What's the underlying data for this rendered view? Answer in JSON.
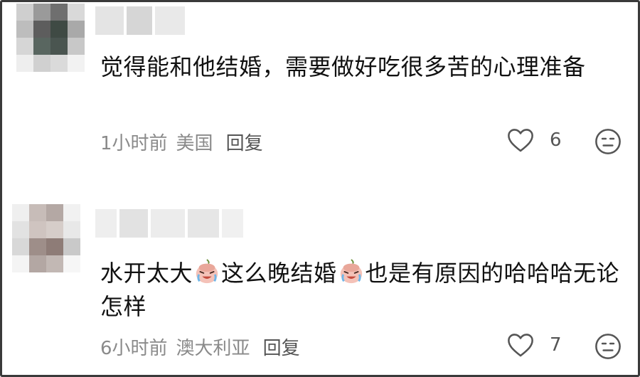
{
  "comments": [
    {
      "text": "觉得能和他结婚，需要做好吃很多苦的心理准备",
      "time": "1小时前",
      "location": "美国",
      "reply_label": "回复",
      "likes": "6"
    },
    {
      "text_parts": [
        "水开太大",
        "这么晚结婚",
        "也是有原因的哈哈哈无论怎样"
      ],
      "time": "6小时前",
      "location": "澳大利亚",
      "reply_label": "回复",
      "likes": "7"
    }
  ],
  "icons": {
    "like": "heart-outline-icon",
    "dislike": "meh-face-icon",
    "inline_emoji": "crying-laughing-emoji"
  },
  "colors": {
    "text": "#111111",
    "meta": "#8a8a8a",
    "icon": "#555555",
    "border": "#3a3a3a"
  }
}
